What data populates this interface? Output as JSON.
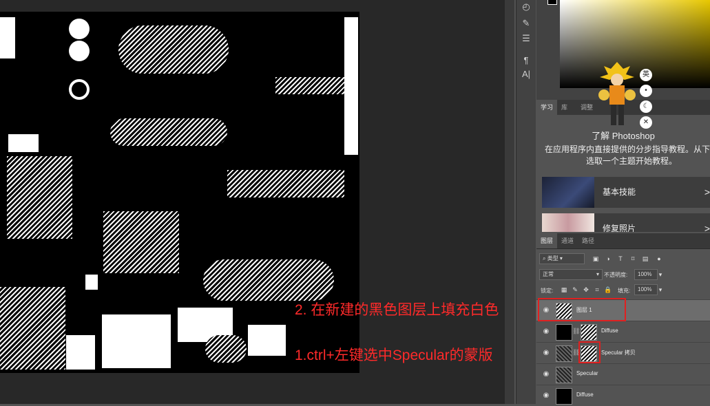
{
  "learn_panel": {
    "tabs": [
      "学习",
      "库",
      "调整"
    ],
    "title": "了解 Photoshop",
    "description": "在应用程序内直接提供的分步指导教程。从下面选取一个主题开始教程。",
    "courses": [
      {
        "label": "基本技能",
        "chevron": ">"
      },
      {
        "label": "修复照片",
        "chevron": ">"
      }
    ]
  },
  "ime_toolbar": {
    "lang": "英",
    "buttons": [
      "•",
      "☾",
      "✕"
    ]
  },
  "layers_panel": {
    "tabs": [
      "图层",
      "通道",
      "路径"
    ],
    "filter_kind": "类型",
    "blend_mode": "正常",
    "opacity_label": "不透明度:",
    "opacity_value": "100%",
    "lock_label": "锁定:",
    "fill_label": "填充:",
    "fill_value": "100%",
    "layers": [
      {
        "name": "图层 1",
        "selected": true
      },
      {
        "name": "Diffuse",
        "selected": false
      },
      {
        "name": "Specular 拷贝",
        "selected": false
      },
      {
        "name": "Specular",
        "selected": false
      },
      {
        "name": "Diffuse",
        "selected": false
      }
    ]
  },
  "annotations": {
    "step2": "2. 在新建的黑色图层上填充白色",
    "step1": "1.ctrl+左键选中Specular的蒙版"
  },
  "colors": {
    "accent_red": "#e02020",
    "picker_hue": "#e8c800"
  }
}
